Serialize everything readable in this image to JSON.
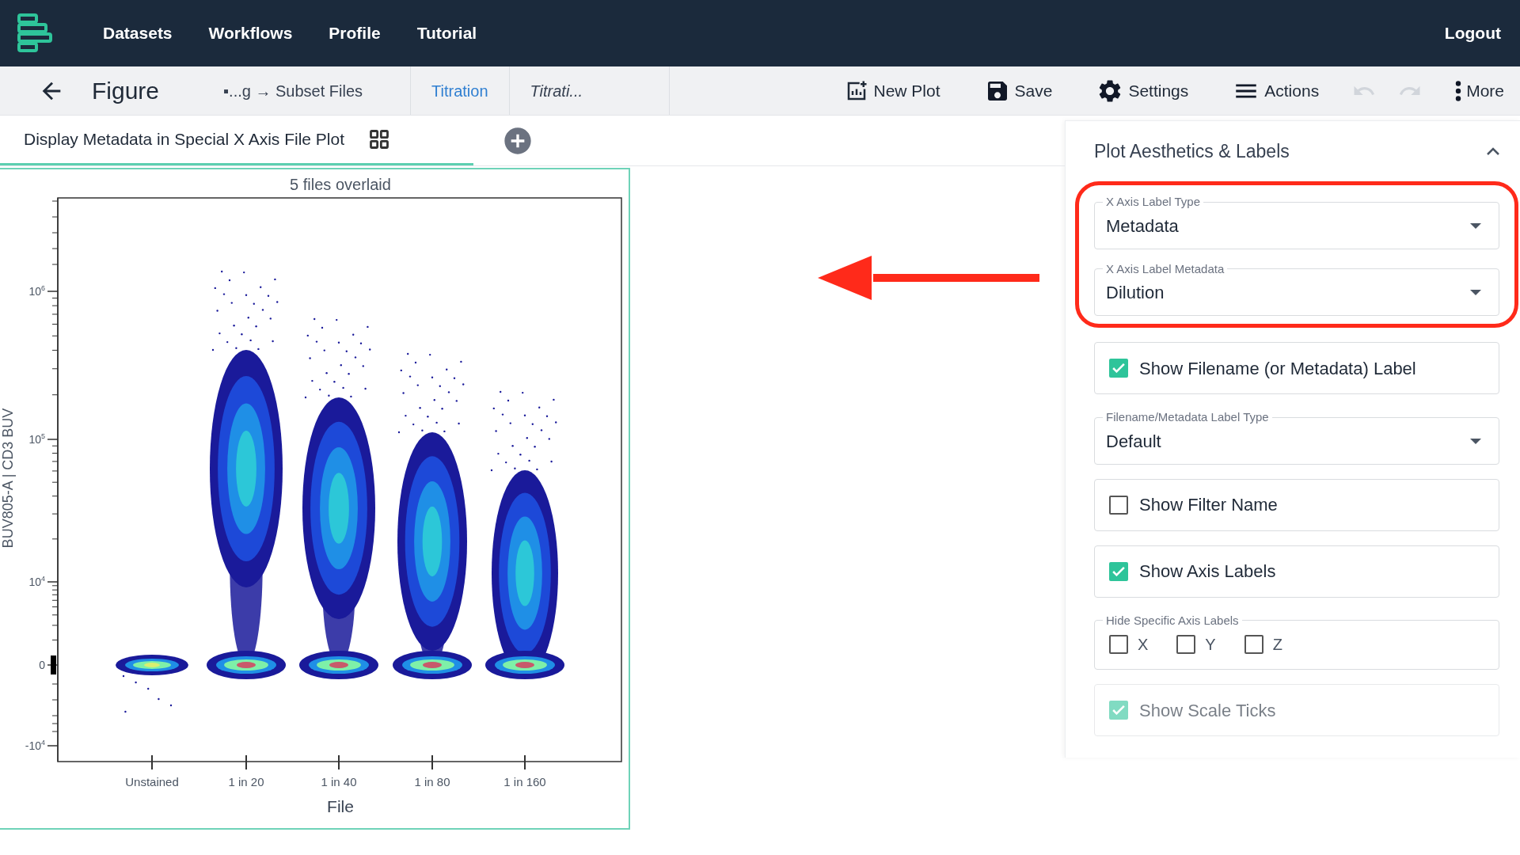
{
  "nav": {
    "items": [
      "Datasets",
      "Workflows",
      "Profile",
      "Tutorial"
    ],
    "logout": "Logout"
  },
  "toolbar": {
    "title": "Figure",
    "breadcrumb": "▪...g → Subset Files",
    "tabs": [
      {
        "label": "Titration",
        "selected": true
      },
      {
        "label": "Titrati...",
        "selected": false
      }
    ],
    "actions": [
      {
        "kind": "new-plot",
        "label": "New Plot"
      },
      {
        "kind": "save",
        "label": "Save"
      },
      {
        "kind": "settings",
        "label": "Settings"
      },
      {
        "kind": "actions",
        "label": "Actions"
      },
      {
        "kind": "undo",
        "disabled": true
      },
      {
        "kind": "redo",
        "disabled": true
      },
      {
        "kind": "more",
        "label": "More"
      }
    ]
  },
  "plot_tabs": [
    {
      "label": "Display Metadata in Special X Axis File Plot",
      "selected": true
    }
  ],
  "plot": {
    "title": "5 files overlaid",
    "x_label": "File",
    "y_label": "BUV805-A | CD3 BUV",
    "categories": [
      "Unstained",
      "1 in 20",
      "1 in 40",
      "1 in 80",
      "1 in 160"
    ],
    "y_ticks": [
      {
        "base": "10",
        "exponent": "6"
      },
      {
        "base": "10",
        "exponent": "5"
      },
      {
        "base": "10",
        "exponent": "4"
      },
      {
        "base": "0"
      },
      {
        "base": "-10",
        "exponent": "4"
      }
    ]
  },
  "panel": {
    "title": "Plot Aesthetics & Labels",
    "expanded": true,
    "controls": [
      {
        "kind": "select",
        "label": "X Axis Label Type",
        "value": "Metadata",
        "highlighted": true
      },
      {
        "kind": "select",
        "label": "X Axis Label Metadata",
        "value": "Dilution",
        "highlighted": true
      },
      {
        "kind": "checkbox",
        "label": "Show Filename (or Metadata) Label",
        "checked": true
      },
      {
        "kind": "select",
        "label": "Filename/Metadata Label Type",
        "value": "Default"
      },
      {
        "kind": "checkbox",
        "label": "Show Filter Name",
        "checked": false
      },
      {
        "kind": "checkbox",
        "label": "Show Axis Labels",
        "checked": true
      },
      {
        "kind": "group",
        "label": "Hide Specific Axis Labels",
        "options": [
          {
            "label": "X",
            "checked": false
          },
          {
            "label": "Y",
            "checked": false
          },
          {
            "label": "Z",
            "checked": false
          }
        ]
      },
      {
        "kind": "checkbox",
        "label": "Show Scale Ticks",
        "checked": true,
        "faded": true
      }
    ]
  }
}
